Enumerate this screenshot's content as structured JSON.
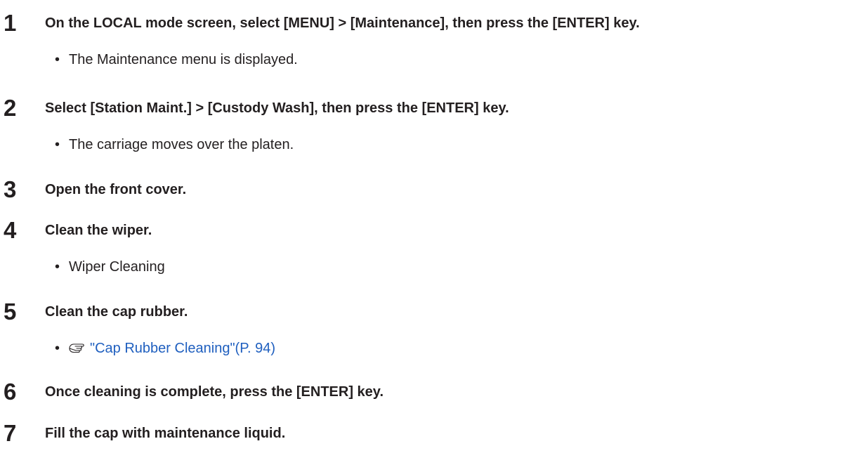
{
  "steps": [
    {
      "number": "1",
      "title": "On the LOCAL mode screen, select [MENU] > [Maintenance], then press the [ENTER] key.",
      "note": "The Maintenance menu is displayed."
    },
    {
      "number": "2",
      "title": "Select [Station Maint.] > [Custody Wash], then press the [ENTER] key.",
      "note": "The carriage moves over the platen."
    },
    {
      "number": "3",
      "title": "Open the front cover."
    },
    {
      "number": "4",
      "title": "Clean the wiper.",
      "note": "Wiper Cleaning"
    },
    {
      "number": "5",
      "title": "Clean the cap rubber.",
      "note_link": "\"Cap Rubber Cleaning\"(P. 94)",
      "note_icon": "pointing-hand-icon"
    },
    {
      "number": "6",
      "title": "Once cleaning is complete, press the [ENTER] key."
    },
    {
      "number": "7",
      "title": "Fill the cap with maintenance liquid."
    }
  ],
  "bullet_char": "•",
  "colors": {
    "text": "#231f20",
    "link": "#1f5fbf"
  }
}
